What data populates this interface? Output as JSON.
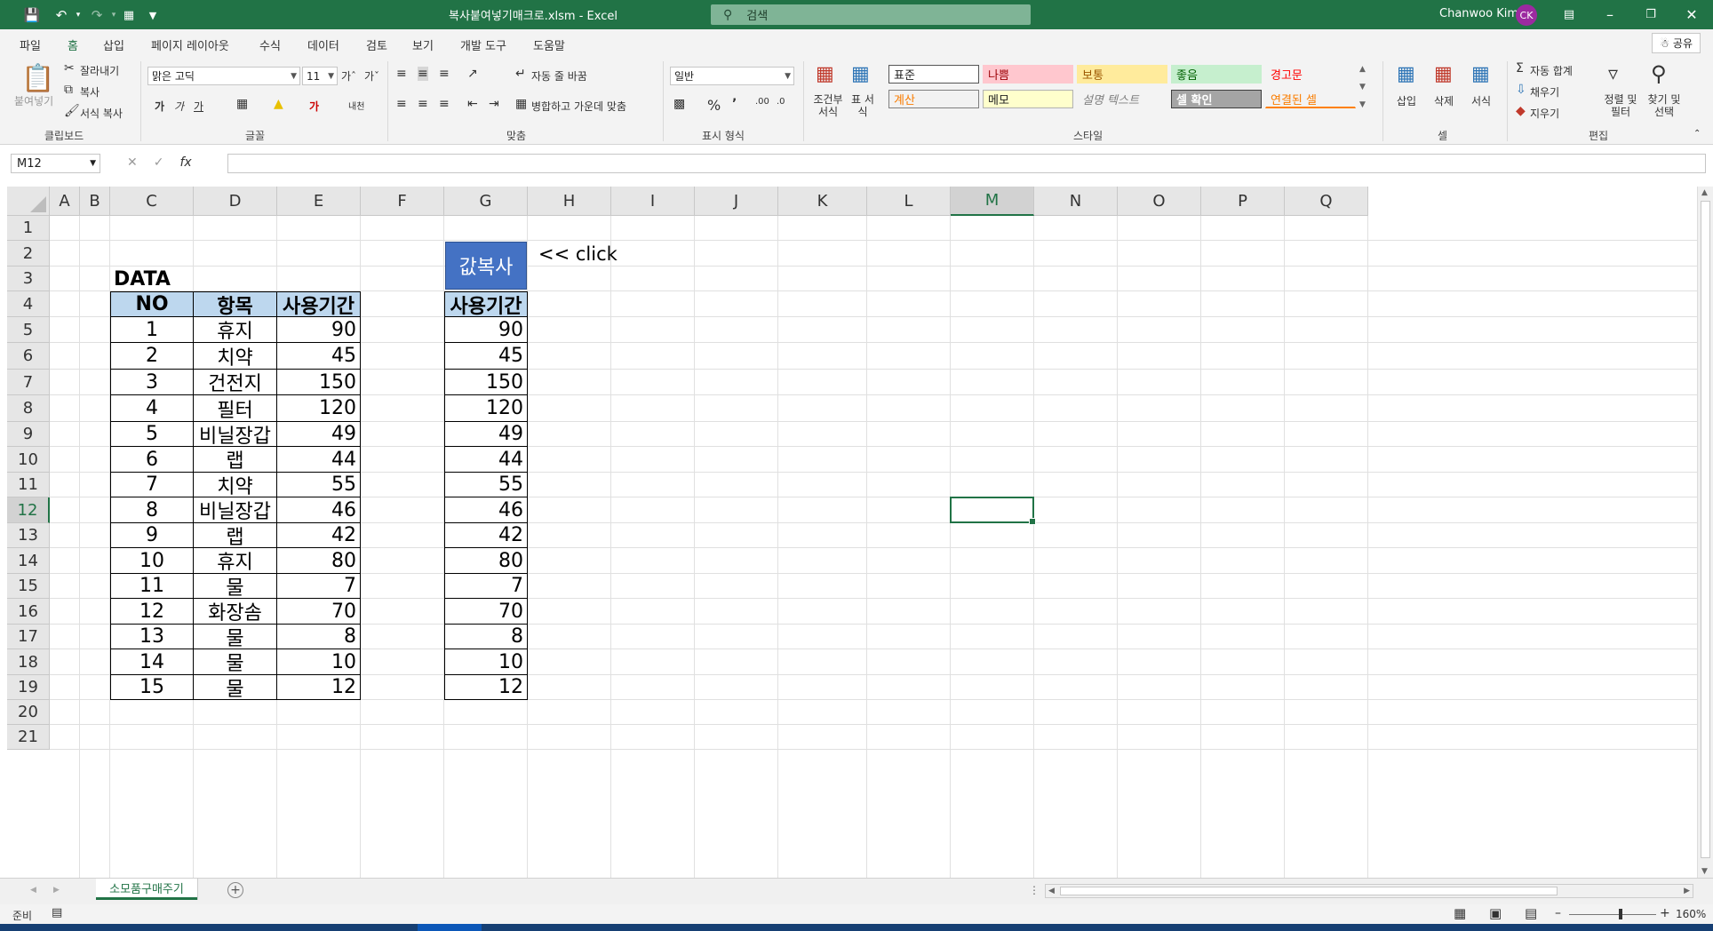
{
  "titlebar": {
    "title": "복사붙여넣기매크로.xlsm  -  Excel",
    "search_placeholder": "검색",
    "user_name": "Chanwoo Kim",
    "user_initials": "CK",
    "accent": "#217346"
  },
  "menu": {
    "tabs": [
      "파일",
      "홈",
      "삽입",
      "페이지 레이아웃",
      "수식",
      "데이터",
      "검토",
      "보기",
      "개발 도구",
      "도움말"
    ],
    "active_tab": "홈",
    "share_label": "공유"
  },
  "ribbon": {
    "clipboard": {
      "paste": "붙여넣기",
      "cut": "잘라내기",
      "copy": "복사",
      "format_painter": "서식 복사",
      "group": "클립보드"
    },
    "font": {
      "name": "맑은 고딕",
      "size": "11",
      "group": "글꼴",
      "bold": "가",
      "italic": "가",
      "underline": "가",
      "font_color": "가",
      "phonetic": "내천"
    },
    "alignment": {
      "wrap": "자동 줄 바꿈",
      "merge": "병합하고 가운데 맞춤",
      "group": "맞춤"
    },
    "number": {
      "format": "일반",
      "group": "표시 형식"
    },
    "styles": {
      "conditional": "조건부 서식",
      "table": "표 서식",
      "cells": [
        "표준",
        "나쁨",
        "보통",
        "좋음",
        "경고문",
        "계산",
        "메모",
        "설명 텍스트",
        "셀 확인",
        "연결된 셀"
      ],
      "group": "스타일"
    },
    "cells_group": {
      "insert": "삽입",
      "delete": "삭제",
      "format": "서식",
      "group": "셀"
    },
    "editing": {
      "autosum": "자동 합계",
      "fill": "채우기",
      "clear": "지우기",
      "sort": "정렬 및 필터",
      "find": "찾기 및 선택",
      "group": "편집"
    }
  },
  "formula_bar": {
    "name_box": "M12",
    "formula": ""
  },
  "grid": {
    "columns": [
      "A",
      "B",
      "C",
      "D",
      "E",
      "F",
      "G",
      "H",
      "I",
      "J",
      "K",
      "L",
      "M",
      "N",
      "O",
      "P",
      "Q"
    ],
    "rows": [
      "1",
      "2",
      "3",
      "4",
      "5",
      "6",
      "7",
      "8",
      "9",
      "10",
      "11",
      "12",
      "13",
      "14",
      "15",
      "16",
      "17",
      "18",
      "19",
      "20",
      "21"
    ],
    "selected_column": "M",
    "selected_row": "12",
    "data_label": "DATA",
    "click_hint": "<< click",
    "macro_button": "값복사",
    "headers": [
      "NO",
      "항목",
      "사용기간"
    ],
    "copy_header": "사용기간",
    "table": [
      [
        "1",
        "휴지",
        "90"
      ],
      [
        "2",
        "치약",
        "45"
      ],
      [
        "3",
        "건전지",
        "150"
      ],
      [
        "4",
        "필터",
        "120"
      ],
      [
        "5",
        "비닐장갑",
        "49"
      ],
      [
        "6",
        "랩",
        "44"
      ],
      [
        "7",
        "치약",
        "55"
      ],
      [
        "8",
        "비닐장갑",
        "46"
      ],
      [
        "9",
        "랩",
        "42"
      ],
      [
        "10",
        "휴지",
        "80"
      ],
      [
        "11",
        "물",
        "7"
      ],
      [
        "12",
        "화장솜",
        "70"
      ],
      [
        "13",
        "물",
        "8"
      ],
      [
        "14",
        "물",
        "10"
      ],
      [
        "15",
        "물",
        "12"
      ]
    ],
    "copied_values": [
      "90",
      "45",
      "150",
      "120",
      "49",
      "44",
      "55",
      "46",
      "42",
      "80",
      "7",
      "70",
      "8",
      "10",
      "12"
    ],
    "header_fill": "#bdd7ee",
    "button_fill": "#4472c4"
  },
  "sheets": {
    "tabs": [
      "소모품구매주기"
    ],
    "active": "소모품구매주기"
  },
  "status": {
    "ready": "준비",
    "zoom": "160%"
  }
}
